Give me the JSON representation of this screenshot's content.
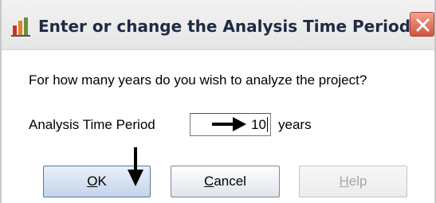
{
  "window": {
    "title": "Enter or change the Analysis Time Period",
    "app_icon": "bar-chart-icon",
    "close_icon": "close-icon"
  },
  "body": {
    "question": "For how many years do you wish to analyze the project?",
    "field_label": "Analysis Time Period",
    "field_value": "10",
    "unit": "years"
  },
  "buttons": {
    "ok": {
      "mnemonic": "O",
      "rest": "K"
    },
    "cancel": {
      "mnemonic": "C",
      "rest": "ancel"
    },
    "help": {
      "mnemonic": "H",
      "rest": "elp",
      "enabled": false
    }
  },
  "annotations": {
    "arrow_to_field": "arrow-right-icon",
    "arrow_to_ok": "arrow-down-icon"
  },
  "colors": {
    "close_button": "#d4533b",
    "title_text": "#1f2a44",
    "disabled_text": "#a6a6a6",
    "default_button_border": "#58749e"
  }
}
